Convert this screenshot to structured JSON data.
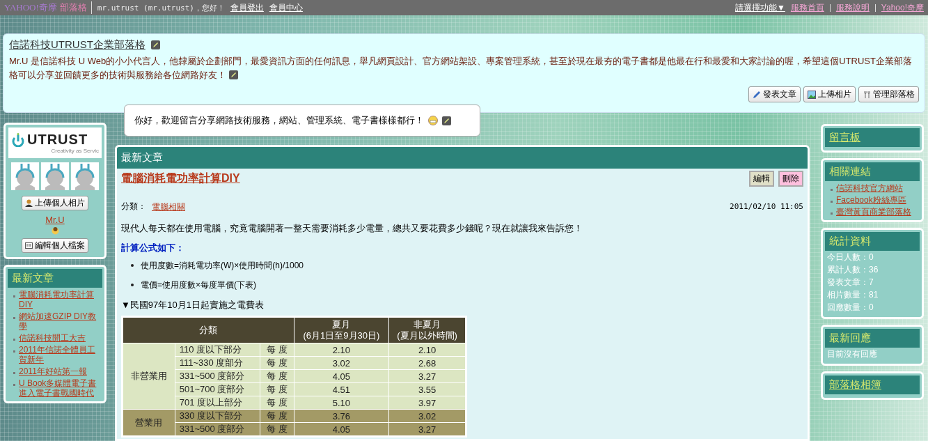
{
  "top_bar": {
    "logo": {
      "brand": "YAHOO!奇摩",
      "product": "部落格"
    },
    "greeting": "mr.utrust (mr.utrust)，您好！",
    "links": [
      "會員登出",
      "會員中心"
    ],
    "function_menu": "請選擇功能▼",
    "service_links": [
      "服務首頁",
      "服務說明",
      "Yahoo!奇摩"
    ]
  },
  "blog_header": {
    "title": "信諾科技UTRUST企業部落格",
    "description": "Mr.U 是信諾科技 U Web的小小代言人，他隸屬於企劃部門，最愛資訊方面的任何訊息，舉凡網頁設計、官方網站架設、專案管理系統，甚至於現在最夯的電子書都是他最在行和最愛和大家討論的喔，希望這個UTRUST企業部落格可以分享並回饋更多的技術與服務給各位網路好友！",
    "actions": [
      {
        "kind": "write",
        "label": "發表文章"
      },
      {
        "kind": "photo",
        "label": "上傳相片"
      },
      {
        "kind": "manage",
        "label": "管理部落格"
      }
    ]
  },
  "greeting_bubble": {
    "text": "你好，歡迎留言分享網路技術服務，網站、管理系統、電子書樣樣都行！"
  },
  "profile": {
    "logo_word": "UTRUST",
    "logo_tagline": "Creativity as Servic",
    "upload_button": "上傳個人相片",
    "name": "Mr.U",
    "edit_button": "編輯個人檔案"
  },
  "recent_posts": {
    "title": "最新文章",
    "items": [
      "電腦消耗電功率計算DIY",
      "網站加速GZIP DIY教學",
      "信諾科技開工大吉",
      "2011年信諾全體員工賀新年",
      "2011年好站第一報",
      "U Book多媒體電子書進入電子書戰國時代"
    ]
  },
  "main": {
    "title": "最新文章",
    "article": {
      "title": "電腦消耗電功率計算DIY",
      "edit": "編輯",
      "delete": "刪除",
      "category_label": "分類：",
      "category": "電腦相關",
      "date": "2011/02/10 11:05",
      "intro": "現代人每天都在使用電腦，究竟電腦開著一整天需要消耗多少電量，總共又要花費多少錢呢？現在就讓我來告訴您！",
      "formula_heading": "計算公式如下：",
      "bullets": [
        "使用度數=消耗電功率(W)×使用時間(h)/1000",
        "電價=使用度數×每度單價(下表)"
      ],
      "table_caption": "▼民國97年10月1日起實施之電費表",
      "table": {
        "columns": [
          {
            "label": "分類"
          },
          {
            "label": "夏月",
            "note": "(6月1日至9月30日)"
          },
          {
            "label": "非夏月",
            "note": "(夏月以外時間)"
          }
        ],
        "groups": [
          {
            "name": "非營業用",
            "color": "#dce6c2",
            "rows": [
              {
                "range": "110 度以下部分",
                "unit": "每 度",
                "summer": "2.10",
                "non_summer": "2.10"
              },
              {
                "range": "111~330 度部分",
                "unit": "每 度",
                "summer": "3.02",
                "non_summer": "2.68"
              },
              {
                "range": "331~500 度部分",
                "unit": "每 度",
                "summer": "4.05",
                "non_summer": "3.27"
              },
              {
                "range": "501~700 度部分",
                "unit": "每 度",
                "summer": "4.51",
                "non_summer": "3.55"
              },
              {
                "range": "701 度以上部分",
                "unit": "每 度",
                "summer": "5.10",
                "non_summer": "3.97"
              }
            ]
          },
          {
            "name": "營業用",
            "color": "#a39a66",
            "rows": [
              {
                "range": "330 度以下部分",
                "unit": "每 度",
                "summer": "3.76",
                "non_summer": "3.02"
              },
              {
                "range": "331~500 度部分",
                "unit": "每 度",
                "summer": "4.05",
                "non_summer": "3.27"
              }
            ]
          }
        ]
      }
    }
  },
  "message_board": {
    "title": "留言板"
  },
  "related_links": {
    "title": "相關連結",
    "items": [
      "信諾科技官方網站",
      "Facebook粉絲專區",
      "臺灣黃頁商業部落格"
    ]
  },
  "statistics": {
    "title": "統計資料",
    "items": [
      "今日人數：0",
      "累計人數：36",
      "發表文章：7",
      "相片數量：81",
      "回應數量：0"
    ]
  },
  "recent_comments": {
    "title": "最新回應",
    "empty": "目前沒有回應"
  },
  "album": {
    "title": "部落格相簿"
  }
}
